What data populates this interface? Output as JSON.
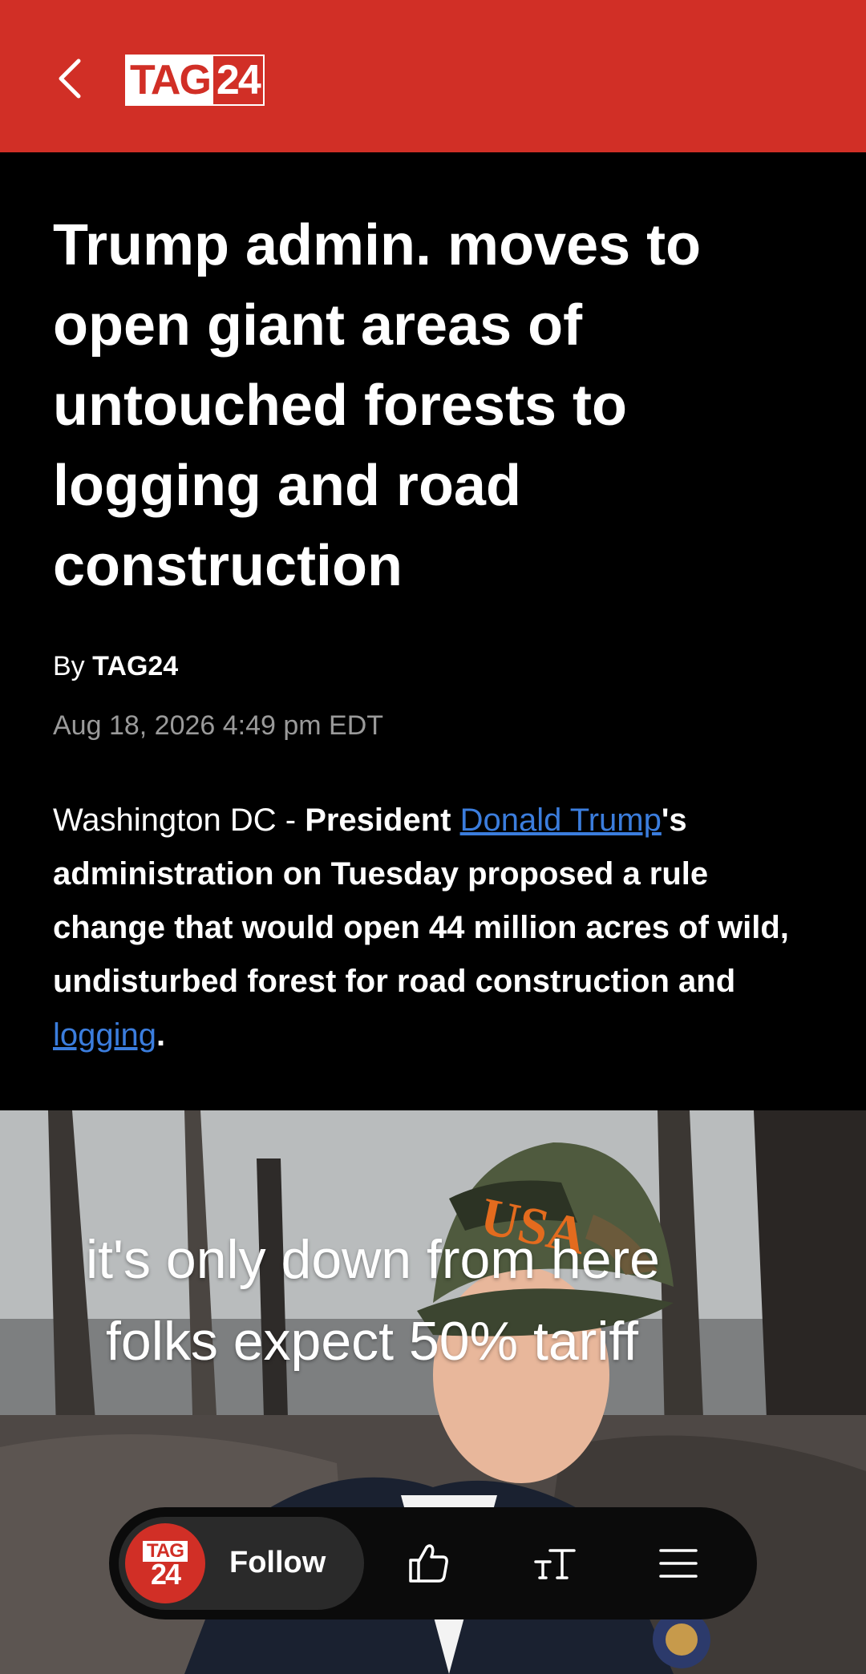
{
  "header": {
    "back_icon": "chevron-left-icon",
    "logo_part1": "TAG",
    "logo_part2": "24",
    "brand_color": "#d12f26"
  },
  "article": {
    "headline": "Trump admin. moves to open giant areas of untouched forests to logging and road construction",
    "byline_prefix": "By",
    "byline_author": "TAG24",
    "date": "Aug 18, 2026 4:49 pm EDT",
    "lead": {
      "part1": "Washington DC - ",
      "part2": "President ",
      "link1": "Donald Trump",
      "part3": "'s administration on Tuesday proposed a rule change that would open 44 million acres of wild, undisturbed forest for road construction and ",
      "link2": "logging",
      "part4": "."
    }
  },
  "photo": {
    "cap_text": "USA",
    "caption_line1": "it's only down from here",
    "caption_line2": "folks expect 50% tariff"
  },
  "bottom_bar": {
    "follow_logo_part1": "TAG",
    "follow_logo_part2": "24",
    "follow_label": "Follow",
    "like_icon": "thumbs-up-icon",
    "text_size_icon": "text-size-icon",
    "menu_icon": "hamburger-menu-icon"
  }
}
